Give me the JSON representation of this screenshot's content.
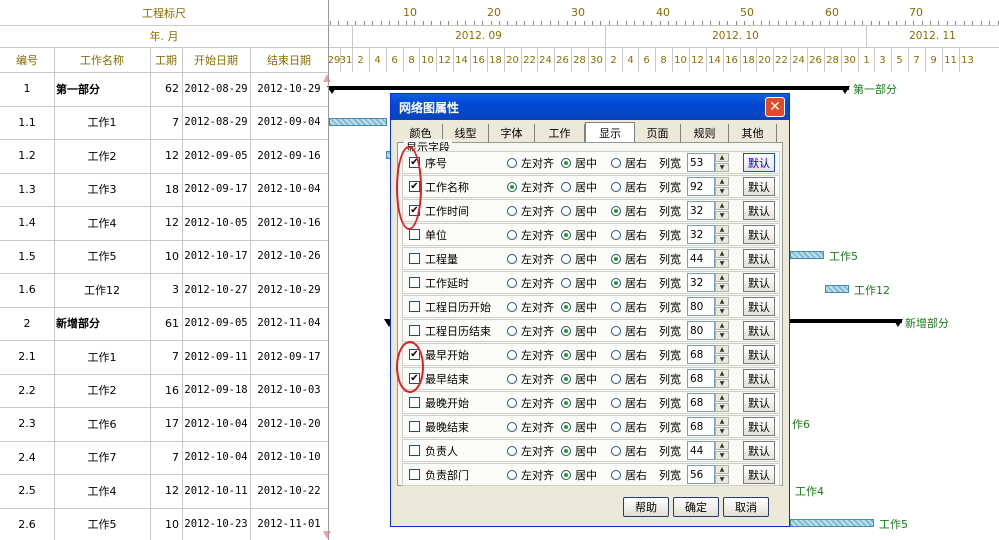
{
  "ruler": {
    "label": "工程标尺",
    "ticks": [
      "10",
      "20",
      "30",
      "40",
      "50",
      "60",
      "70"
    ]
  },
  "month_row": {
    "label": "年. 月",
    "months": [
      "2012. 09",
      "2012. 10",
      "2012. 11"
    ]
  },
  "columns": [
    "编号",
    "工作名称",
    "工期",
    "开始日期",
    "结束日期"
  ],
  "days": [
    "29",
    "31",
    "2",
    "4",
    "6",
    "8",
    "10",
    "12",
    "14",
    "16",
    "18",
    "20",
    "22",
    "24",
    "26",
    "28",
    "30",
    "2",
    "4",
    "6",
    "8",
    "10",
    "12",
    "14",
    "16",
    "18",
    "20",
    "22",
    "24",
    "26",
    "28",
    "30",
    "1",
    "3",
    "5",
    "7",
    "9",
    "11",
    "13"
  ],
  "rows": [
    {
      "id": "1",
      "name": "第一部分",
      "dur": "62",
      "start": "2012-08-29",
      "end": "2012-10-29",
      "group": true
    },
    {
      "id": "1.1",
      "name": "工作1",
      "dur": "7",
      "start": "2012-08-29",
      "end": "2012-09-04"
    },
    {
      "id": "1.2",
      "name": "工作2",
      "dur": "12",
      "start": "2012-09-05",
      "end": "2012-09-16"
    },
    {
      "id": "1.3",
      "name": "工作3",
      "dur": "18",
      "start": "2012-09-17",
      "end": "2012-10-04"
    },
    {
      "id": "1.4",
      "name": "工作4",
      "dur": "12",
      "start": "2012-10-05",
      "end": "2012-10-16"
    },
    {
      "id": "1.5",
      "name": "工作5",
      "dur": "10",
      "start": "2012-10-17",
      "end": "2012-10-26"
    },
    {
      "id": "1.6",
      "name": "工作12",
      "dur": "3",
      "start": "2012-10-27",
      "end": "2012-10-29"
    },
    {
      "id": "2",
      "name": "新增部分",
      "dur": "61",
      "start": "2012-09-05",
      "end": "2012-11-04",
      "group": true
    },
    {
      "id": "2.1",
      "name": "工作1",
      "dur": "7",
      "start": "2012-09-11",
      "end": "2012-09-17"
    },
    {
      "id": "2.2",
      "name": "工作2",
      "dur": "16",
      "start": "2012-09-18",
      "end": "2012-10-03"
    },
    {
      "id": "2.3",
      "name": "工作6",
      "dur": "17",
      "start": "2012-10-04",
      "end": "2012-10-20"
    },
    {
      "id": "2.4",
      "name": "工作7",
      "dur": "7",
      "start": "2012-10-04",
      "end": "2012-10-10"
    },
    {
      "id": "2.5",
      "name": "工作4",
      "dur": "12",
      "start": "2012-10-11",
      "end": "2012-10-22"
    },
    {
      "id": "2.6",
      "name": "工作5",
      "dur": "10",
      "start": "2012-10-23",
      "end": "2012-11-01"
    }
  ],
  "gantt_labels": {
    "g1": "第一部分",
    "w5": "工作5",
    "w12": "工作12",
    "g2": "新增部分",
    "w6": "作6",
    "w4": "工作4",
    "w5b": "工作5"
  },
  "dialog": {
    "title": "网络图属性",
    "close": "✕",
    "tabs": [
      "颜色",
      "线型",
      "字体",
      "工作",
      "显示",
      "页面",
      "规则",
      "其他"
    ],
    "active_tab": "显示",
    "group_label": "显示字段",
    "align_left": "左对齐",
    "align_center": "居中",
    "align_right": "居右",
    "col_width_label": "列宽",
    "default_label": "默认",
    "fields": [
      {
        "name": "序号",
        "checked": true,
        "align": "center",
        "width": "53"
      },
      {
        "name": "工作名称",
        "checked": true,
        "align": "left",
        "width": "92"
      },
      {
        "name": "工作时间",
        "checked": true,
        "align": "right",
        "width": "32"
      },
      {
        "name": "单位",
        "checked": false,
        "align": "center",
        "width": "32"
      },
      {
        "name": "工程量",
        "checked": false,
        "align": "right",
        "width": "44"
      },
      {
        "name": "工作延时",
        "checked": false,
        "align": "right",
        "width": "32"
      },
      {
        "name": "工程日历开始",
        "checked": false,
        "align": "center",
        "width": "80"
      },
      {
        "name": "工程日历结束",
        "checked": false,
        "align": "center",
        "width": "80"
      },
      {
        "name": "最早开始",
        "checked": true,
        "align": "center",
        "width": "68"
      },
      {
        "name": "最早结束",
        "checked": true,
        "align": "center",
        "width": "68"
      },
      {
        "name": "最晚开始",
        "checked": false,
        "align": "center",
        "width": "68"
      },
      {
        "name": "最晚结束",
        "checked": false,
        "align": "center",
        "width": "68"
      },
      {
        "name": "负责人",
        "checked": false,
        "align": "center",
        "width": "44"
      },
      {
        "name": "负责部门",
        "checked": false,
        "align": "center",
        "width": "56"
      }
    ],
    "buttons": {
      "help": "帮助",
      "ok": "确定",
      "cancel": "取消"
    },
    "check_mark": "✔"
  }
}
